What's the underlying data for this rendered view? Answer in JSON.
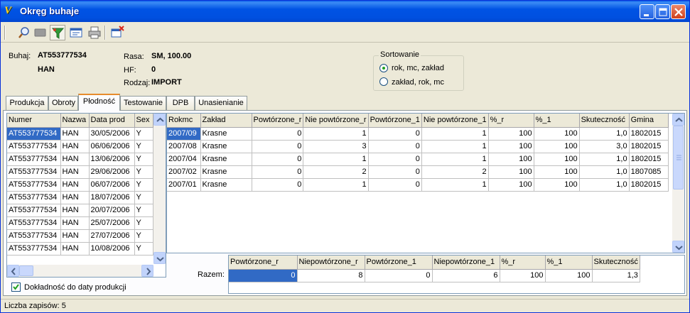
{
  "window": {
    "title": "Okręg buhaje",
    "app_icon_glyph": "V"
  },
  "toolbar": {
    "icons": [
      "search-icon",
      "tag-icon",
      "filter-icon",
      "form-icon",
      "print-icon",
      "exit-icon"
    ]
  },
  "info": {
    "buhaj_label": "Buhaj:",
    "buhaj_value": "AT553777534",
    "nazwa_value": "HAN",
    "rasa_label": "Rasa:",
    "rasa_value": "SM, 100.00",
    "hf_label": "HF:",
    "hf_value": "0",
    "rodzaj_label": "Rodzaj:",
    "rodzaj_value": "IMPORT"
  },
  "sort": {
    "legend": "Sortowanie",
    "options": [
      "rok, mc, zakład",
      "zakład, rok, mc"
    ],
    "selected": 0
  },
  "tabs": [
    "Produkcja",
    "Obroty",
    "Płodność",
    "Testowanie",
    "DPB",
    "Unasienianie"
  ],
  "active_tab": "Płodność",
  "left_grid": {
    "headers": [
      "Numer",
      "Nazwa",
      "Data prod",
      "Sex"
    ],
    "rows": [
      [
        "AT553777534",
        "HAN",
        "30/05/2006",
        "Y"
      ],
      [
        "AT553777534",
        "HAN",
        "06/06/2006",
        "Y"
      ],
      [
        "AT553777534",
        "HAN",
        "13/06/2006",
        "Y"
      ],
      [
        "AT553777534",
        "HAN",
        "29/06/2006",
        "Y"
      ],
      [
        "AT553777534",
        "HAN",
        "06/07/2006",
        "Y"
      ],
      [
        "AT553777534",
        "HAN",
        "18/07/2006",
        "Y"
      ],
      [
        "AT553777534",
        "HAN",
        "20/07/2006",
        "Y"
      ],
      [
        "AT553777534",
        "HAN",
        "25/07/2006",
        "Y"
      ],
      [
        "AT553777534",
        "HAN",
        "27/07/2006",
        "Y"
      ],
      [
        "AT553777534",
        "HAN",
        "10/08/2006",
        "Y"
      ]
    ]
  },
  "main_grid": {
    "headers": [
      "Rokmc",
      "Zakład",
      "Powtórzone_r",
      "Nie powtórzone_r",
      "Powtórzone_1",
      "Nie powtórzone_1",
      "%_r",
      "%_1",
      "Skuteczność",
      "Gmina"
    ],
    "rows": [
      [
        "2007/09",
        "Krasne",
        "0",
        "1",
        "0",
        "1",
        "100",
        "100",
        "1,0",
        "1802015"
      ],
      [
        "2007/08",
        "Krasne",
        "0",
        "3",
        "0",
        "1",
        "100",
        "100",
        "3,0",
        "1802015"
      ],
      [
        "2007/04",
        "Krasne",
        "0",
        "1",
        "0",
        "1",
        "100",
        "100",
        "1,0",
        "1802015"
      ],
      [
        "2007/02",
        "Krasne",
        "0",
        "2",
        "0",
        "2",
        "100",
        "100",
        "1,0",
        "1807085"
      ],
      [
        "2007/01",
        "Krasne",
        "0",
        "1",
        "0",
        "1",
        "100",
        "100",
        "1,0",
        "1802015"
      ]
    ]
  },
  "totals": {
    "label": "Razem:",
    "headers": [
      "Powtórzone_r",
      "Niepowtórzone_r",
      "Powtórzone_1",
      "Niepowtórzone_1",
      "%_r",
      "%_1",
      "Skuteczność"
    ],
    "values": [
      "0",
      "8",
      "0",
      "6",
      "100",
      "100",
      "1,3"
    ]
  },
  "checkbox": {
    "label": "Dokładność do daty produkcji",
    "checked": true
  },
  "status": {
    "text": "Liczba zapisów: 5"
  },
  "colors": {
    "selection": "#316ac5",
    "title_bar": "#0053e4",
    "window_bg": "#ece9d8"
  }
}
